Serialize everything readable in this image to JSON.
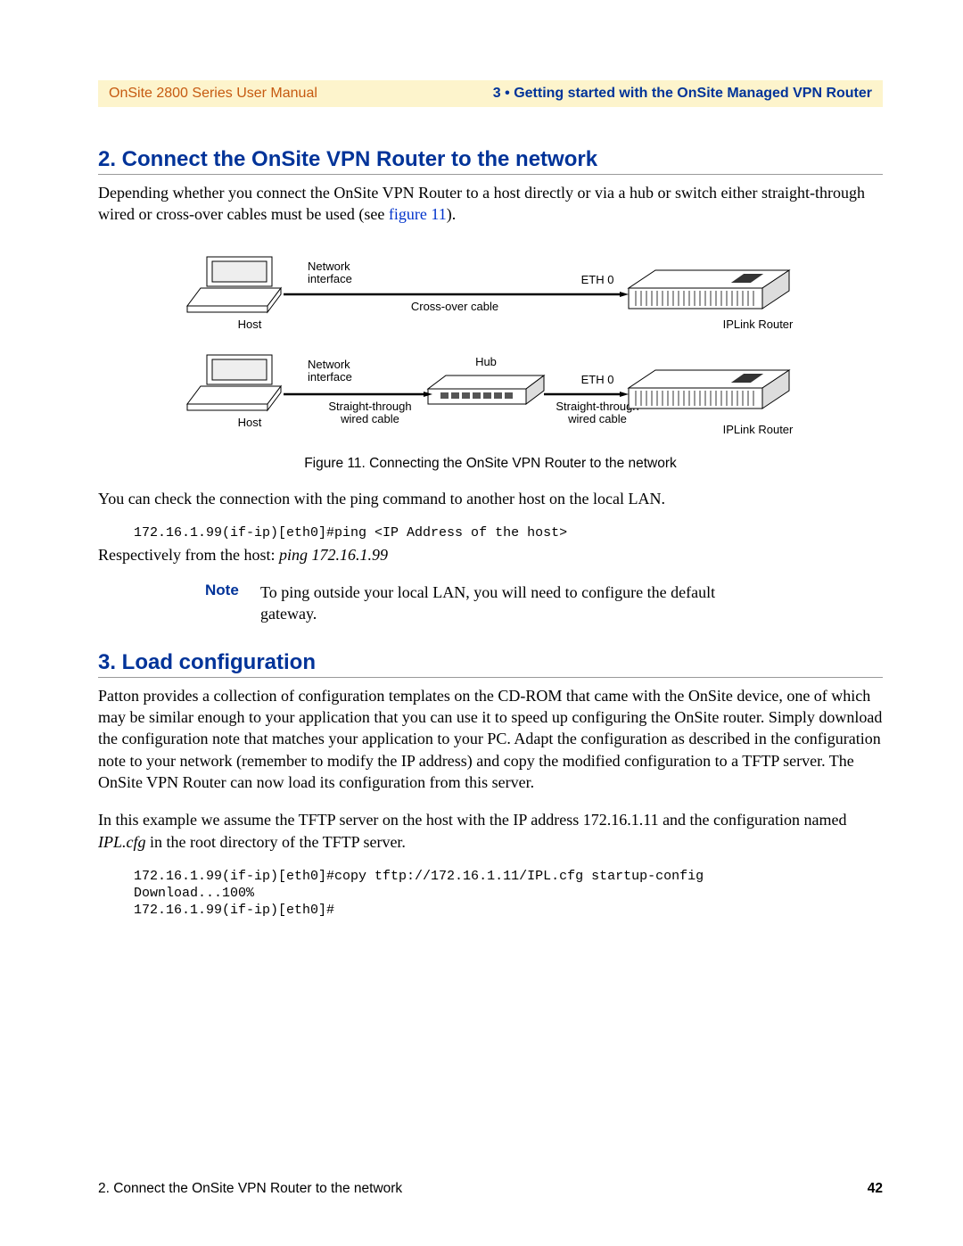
{
  "header": {
    "left": "OnSite 2800 Series User Manual",
    "right": "3 • Getting started with the OnSite Managed VPN Router"
  },
  "section2": {
    "heading": "2. Connect the OnSite VPN Router to the network",
    "para1_a": "Depending whether you connect the OnSite VPN Router to a host directly or via a hub or switch either straight-through wired or cross-over cables must be used (see ",
    "fig_link": "figure 11",
    "para1_b": ").",
    "fig_caption": "Figure 11. Connecting the OnSite VPN Router to the network",
    "para2": "You can check the connection with the ping command to another host on the local LAN.",
    "code1": "172.16.1.99(if-ip)[eth0]#ping <IP Address of the host>",
    "para3_a": "Respectively from the host: ",
    "para3_i": "ping 172.16.1.99",
    "note_label": "Note",
    "note_text": "To ping outside your local LAN, you will need to configure the default gateway."
  },
  "diagram": {
    "net_if": "Network interface",
    "host": "Host",
    "crossover": "Cross-over cable",
    "eth0": "ETH 0",
    "iplink": "IPLink Router",
    "hub": "Hub",
    "st_wired": "Straight-through wired cable"
  },
  "section3": {
    "heading": "3. Load configuration",
    "para1": "Patton provides a collection of configuration templates on the CD-ROM that came with the OnSite device, one of which may be similar enough to your application that you can use it to speed up configuring the OnSite router. Simply download the configuration note that matches your application to your PC. Adapt the configuration as described in the configuration note to your network (remember to modify the IP address) and copy the modified configuration to a TFTP server. The OnSite VPN Router can now load its configuration from this server.",
    "para2_a": "In this example we assume the TFTP server on the host with the IP address 172.16.1.11 and the configuration named ",
    "para2_i": "IPL.cfg",
    "para2_b": " in the root directory of the TFTP server.",
    "code1": "172.16.1.99(if-ip)[eth0]#copy tftp://172.16.1.11/IPL.cfg startup-config",
    "code2": "Download...100%",
    "code3": "172.16.1.99(if-ip)[eth0]#"
  },
  "footer": {
    "left": "2. Connect the OnSite VPN Router to the network",
    "page": "42"
  }
}
